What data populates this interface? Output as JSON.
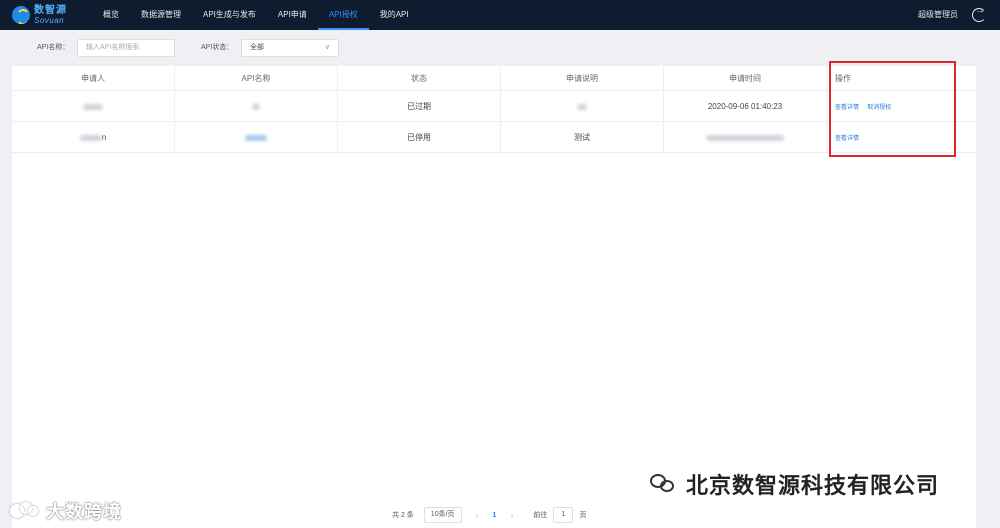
{
  "brand": {
    "name_cn": "数智源",
    "name_en": "Sovuan"
  },
  "nav": {
    "items": [
      "概览",
      "数据源管理",
      "API生成与发布",
      "API申请",
      "API授权",
      "我的API"
    ],
    "active": "API授权"
  },
  "user": {
    "name": "超级管理员"
  },
  "filters": {
    "api_name_label": "API名称：",
    "api_name_placeholder": "输入API名称搜索",
    "api_status_label": "API状态：",
    "api_status_value": "全部"
  },
  "table": {
    "headers": [
      "申请人",
      "API名称",
      "状态",
      "申请说明",
      "申请时间",
      "操作"
    ],
    "rows": [
      {
        "applicant": "",
        "api_name": "",
        "status": "已过期",
        "description": "",
        "time": "2020-09-06 01:40:23",
        "actions": [
          "查看详情",
          "取消授权"
        ]
      },
      {
        "applicant": "n",
        "api_name": "",
        "status": "已停用",
        "description": "测试",
        "time": "",
        "actions": [
          "查看详情"
        ]
      }
    ]
  },
  "pagination": {
    "total": "共 2 条",
    "page_size": "10条/页",
    "current_page": "1",
    "goto_label": "前往",
    "goto_value": "1",
    "goto_unit": "页"
  },
  "watermarks": {
    "left": "大数跨境",
    "right": "北京数智源科技有限公司"
  },
  "colors": {
    "nav_bg": "#0f1b2e",
    "accent": "#2d7be0",
    "highlight_box": "#e0262c"
  }
}
